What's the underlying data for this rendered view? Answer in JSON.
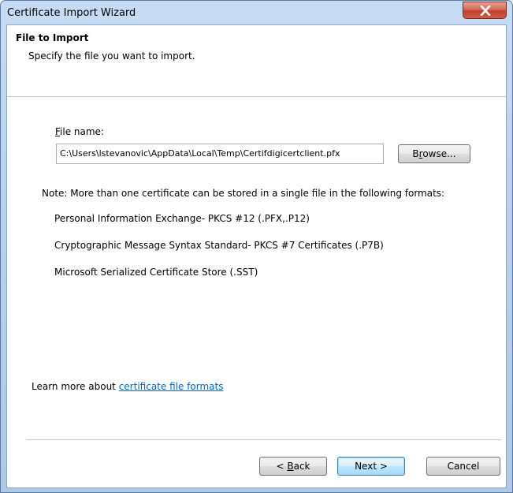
{
  "window": {
    "title": "Certificate Import Wizard"
  },
  "header": {
    "title": "File to Import",
    "subtitle": "Specify the file you want to import."
  },
  "file": {
    "label_access_key": "F",
    "label_rest": "ile name:",
    "value": "C:\\Users\\lstevanovic\\AppData\\Local\\Temp\\Certifdigicertclient.pfx",
    "browse_pre": "B",
    "browse_key": "r",
    "browse_post": "owse..."
  },
  "note": {
    "text": "Note:  More than one certificate can be stored in a single file in the following formats:",
    "formats": [
      "Personal Information Exchange- PKCS #12 (.PFX,.P12)",
      "Cryptographic Message Syntax Standard- PKCS #7 Certificates (.P7B)",
      "Microsoft Serialized Certificate Store (.SST)"
    ]
  },
  "learn": {
    "prefix": "Learn more about ",
    "link": "certificate file formats"
  },
  "footer": {
    "back_pre": "< ",
    "back_key": "B",
    "back_post": "ack",
    "next": "Next >",
    "cancel": "Cancel"
  },
  "icons": {
    "close": "close-x-icon"
  },
  "colors": {
    "link": "#0066cc",
    "close_button": "#c0402c",
    "default_button_border": "#3c7fb1"
  }
}
